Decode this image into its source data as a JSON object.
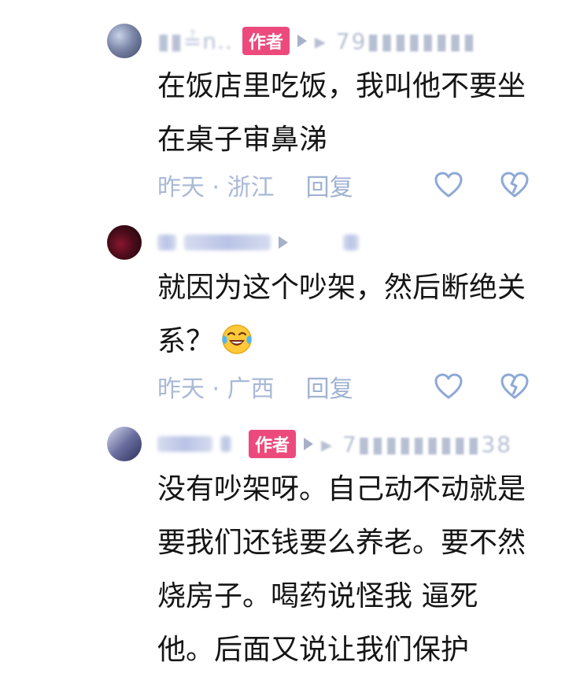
{
  "comments": [
    {
      "username": "▮▮≟n..",
      "ip_masked": "▸ 79▮▮▮▮▮▮▮▮",
      "author_badge": "作者",
      "text": "在饭店里吃饭，我叫他不要坐在桌子审鼻涕",
      "time_location": "昨天 · 浙江",
      "reply_label": "回复"
    },
    {
      "text": "就因为这个吵架，然后断绝关系？",
      "emoji": "laugh-cry-emoji",
      "time_location": "昨天 · 广西",
      "reply_label": "回复"
    },
    {
      "author_badge": "作者",
      "ip_masked": "▸ 7▮▮▮▮▮▮▮▮▮38",
      "text": "没有吵架呀。自己动不动就是要我们还钱要么养老。要不然烧房子。喝药说怪我 逼死他。后面又说让我们保护"
    }
  ],
  "colors": {
    "author_badge_bg": "#ec4a7c",
    "meta_text": "#a9b9d6",
    "body_text": "#151515"
  },
  "icons": [
    "heart-icon",
    "broken-heart-icon",
    "play-icon",
    "laugh-cry-emoji"
  ]
}
